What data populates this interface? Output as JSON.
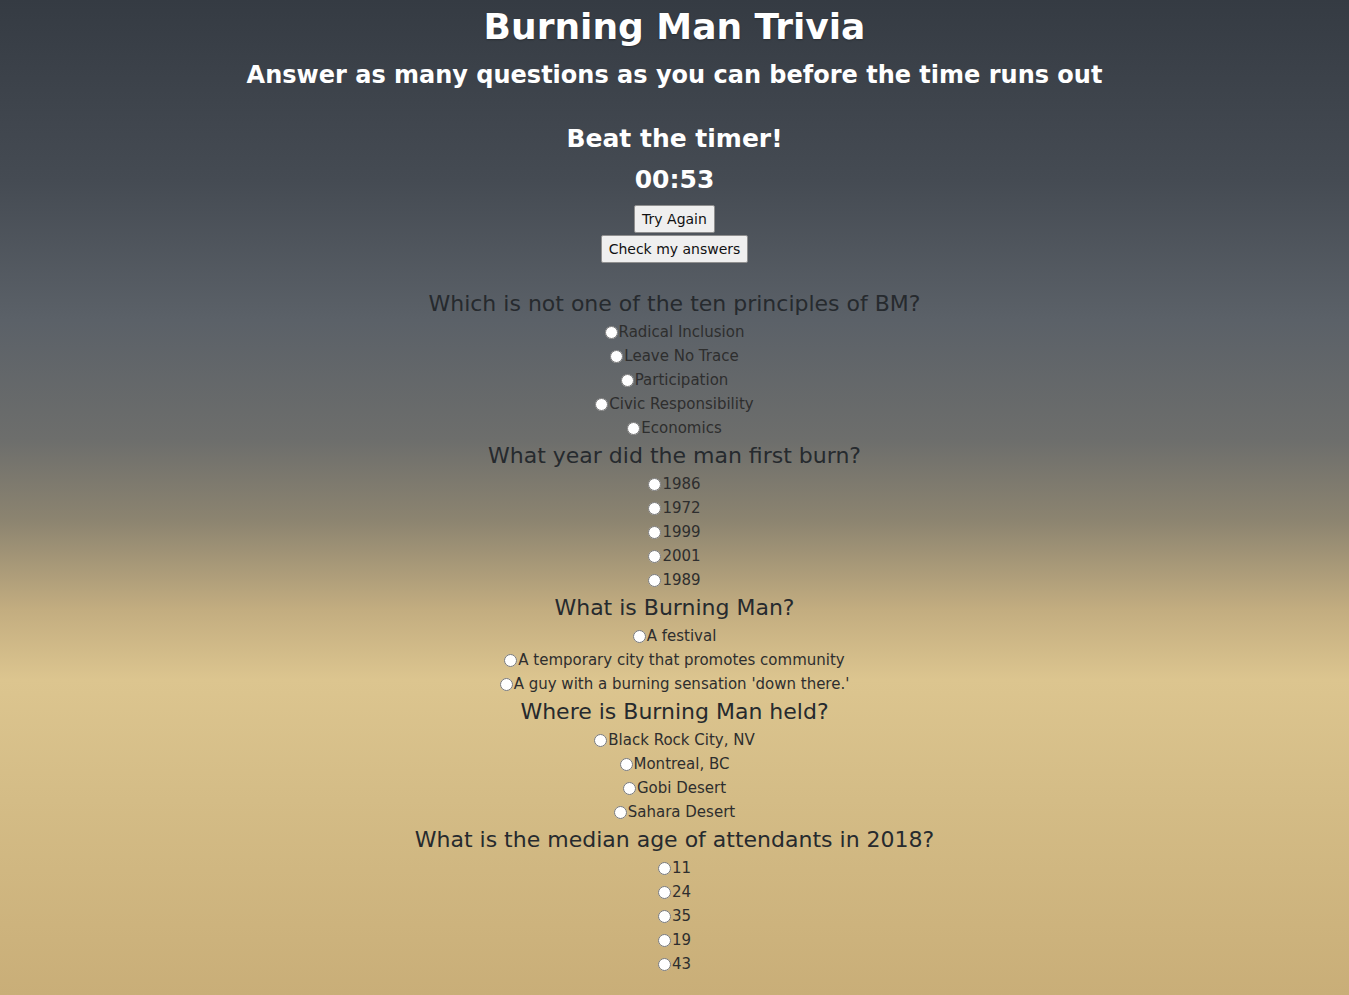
{
  "page": {
    "title": "Burning Man Trivia",
    "subtitle": "Answer as many questions as you can before the time runs out"
  },
  "timer": {
    "label": "Beat the timer!",
    "time": "00:53"
  },
  "buttons": [
    "Try Again",
    "Check my answers"
  ],
  "questions": [
    {
      "question": "Which is not one of the ten principles of BM?",
      "options": [
        {
          "label": "Radical Inclusion",
          "selected": false
        },
        {
          "label": "Leave No Trace",
          "selected": false
        },
        {
          "label": "Participation",
          "selected": false
        },
        {
          "label": "Civic Responsibility",
          "selected": false
        },
        {
          "label": "Economics",
          "selected": false
        }
      ]
    },
    {
      "question": "What year did the man first burn?",
      "options": [
        {
          "label": "1986",
          "selected": false
        },
        {
          "label": "1972",
          "selected": false
        },
        {
          "label": "1999",
          "selected": false
        },
        {
          "label": "2001",
          "selected": false
        },
        {
          "label": "1989",
          "selected": false
        }
      ]
    },
    {
      "question": "What is Burning Man?",
      "options": [
        {
          "label": "A festival",
          "selected": false
        },
        {
          "label": "A temporary city that promotes community",
          "selected": false
        },
        {
          "label": "A guy with a burning sensation 'down there.'",
          "selected": false
        }
      ]
    },
    {
      "question": "Where is Burning Man held?",
      "options": [
        {
          "label": "Black Rock City, NV",
          "selected": false
        },
        {
          "label": "Montreal, BC",
          "selected": false
        },
        {
          "label": "Gobi Desert",
          "selected": false
        },
        {
          "label": "Sahara Desert",
          "selected": false
        }
      ]
    },
    {
      "question": "What is the median age of attendants in 2018?",
      "options": [
        {
          "label": "11",
          "selected": false
        },
        {
          "label": "24",
          "selected": false
        },
        {
          "label": "35",
          "selected": false
        },
        {
          "label": "19",
          "selected": false
        },
        {
          "label": "43",
          "selected": false
        }
      ]
    }
  ]
}
